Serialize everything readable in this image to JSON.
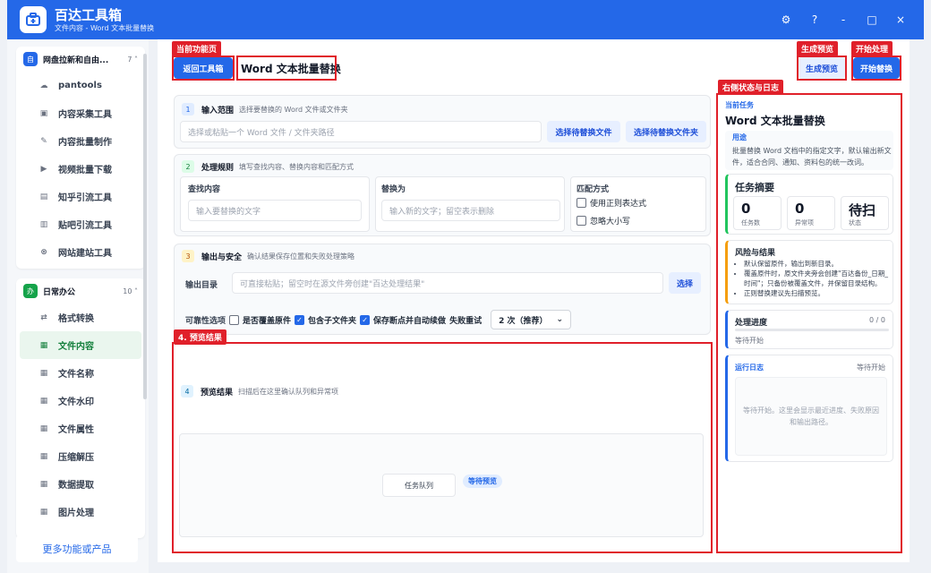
{
  "app": {
    "title": "百达工具箱",
    "subtitle": "文件内容 - Word 文本批量替换",
    "window_controls": [
      "⚙",
      "?",
      "-",
      "□",
      "×"
    ]
  },
  "sidebar": {
    "groups": [
      {
        "badge": "自",
        "title": "网盘拉新和自由...",
        "count": "7 ˄",
        "items": [
          {
            "icon": "cloud-icon",
            "glyph": "☁",
            "label": "pantools"
          },
          {
            "icon": "collect-icon",
            "glyph": "▣",
            "label": "内容采集工具"
          },
          {
            "icon": "edit-icon",
            "glyph": "✎",
            "label": "内容批量制作"
          },
          {
            "icon": "video-icon",
            "glyph": "▶",
            "label": "视频批量下载"
          },
          {
            "icon": "zhihu-icon",
            "glyph": "▤",
            "label": "知乎引流工具"
          },
          {
            "icon": "tieba-icon",
            "glyph": "▥",
            "label": "贴吧引流工具"
          },
          {
            "icon": "globe-icon",
            "glyph": "⊗",
            "label": "网站建站工具"
          }
        ]
      },
      {
        "badge": "办",
        "title": "日常办公",
        "count": "10 ˄",
        "items": [
          {
            "icon": "convert-icon",
            "glyph": "⇄",
            "label": "格式转换"
          },
          {
            "icon": "grid-icon",
            "glyph": "▦",
            "label": "文件内容",
            "active": true
          },
          {
            "icon": "grid-icon",
            "glyph": "▦",
            "label": "文件名称"
          },
          {
            "icon": "grid-icon",
            "glyph": "▦",
            "label": "文件水印"
          },
          {
            "icon": "grid-icon",
            "glyph": "▦",
            "label": "文件属性"
          },
          {
            "icon": "grid-icon",
            "glyph": "▦",
            "label": "压缩解压"
          },
          {
            "icon": "grid-icon",
            "glyph": "▦",
            "label": "数据提取"
          },
          {
            "icon": "grid-icon",
            "glyph": "▦",
            "label": "图片处理"
          }
        ]
      }
    ],
    "more_label": "更多功能或产品"
  },
  "callouts": {
    "current_page": "当前功能页",
    "preview_btn": "生成预览",
    "start_btn": "开始处理",
    "right_status": "右侧状态与日志",
    "preview_result": "4. 预览结果"
  },
  "toolbar": {
    "back_label": "返回工具箱",
    "page_title": "Word 文本批量替换",
    "preview_label": "生成预览",
    "start_label": "开始替换"
  },
  "section1": {
    "num": "1",
    "title": "输入范围",
    "desc": "选择要替换的 Word 文件或文件夹",
    "input_placeholder": "选择或粘贴一个 Word 文件 / 文件夹路径",
    "btn_file": "选择待替换文件",
    "btn_folder": "选择待替换文件夹"
  },
  "section2": {
    "num": "2",
    "title": "处理规则",
    "desc": "填写查找内容、替换内容和匹配方式",
    "find_label": "查找内容",
    "find_placeholder": "输入要替换的文字",
    "replace_label": "替换为",
    "replace_placeholder": "输入新的文字；留空表示删除",
    "match_label": "匹配方式",
    "regex_label": "使用正则表达式",
    "ignore_case_label": "忽略大小写"
  },
  "section3": {
    "num": "3",
    "title": "输出与安全",
    "desc": "确认结果保存位置和失败处理策略",
    "output_label": "输出目录",
    "output_placeholder": "可直接粘贴；留空时在源文件旁创建\"百达处理结果\"",
    "choose_label": "选择",
    "reliability_label": "可靠性选项",
    "overwrite_label": "是否覆盖原件",
    "include_sub_label": "包含子文件夹",
    "save_breakpoint_label": "保存断点并自动续做",
    "retry_label": "失败重试",
    "retry_value": "2 次（推荐）"
  },
  "section4": {
    "num": "4",
    "title": "预览结果",
    "desc": "扫描后在这里确认队列和异常项",
    "queue_label": "任务队列",
    "status_tag": "等待预览"
  },
  "right": {
    "current_task_label": "当前任务",
    "task_title": "Word 文本批量替换",
    "purpose_label": "用途",
    "purpose_text": "批量替换 Word 文档中的指定文字，默认输出新文件，适合合同、通知、资料包的统一改词。",
    "summary_title": "任务摘要",
    "stats": [
      {
        "value": "0",
        "key": "任务数"
      },
      {
        "value": "0",
        "key": "异常项"
      },
      {
        "value": "待扫",
        "key": "状态"
      }
    ],
    "risk_title": "风险与结果",
    "risks": [
      "默认保留原件，输出到新目录。",
      "覆盖原件时，原文件夹旁会创建\"百达备份_日期_时间\"；只备份被覆盖文件，并保留目录结构。",
      "正则替换建议先扫描预览。"
    ],
    "progress_title": "处理进度",
    "progress_value": "0 / 0",
    "progress_fraction": 0,
    "progress_status": "等待开始",
    "log_title": "运行日志",
    "log_status": "等待开始",
    "log_placeholder": "等待开始。这里会显示最近进度、失败原因和输出路径。"
  }
}
